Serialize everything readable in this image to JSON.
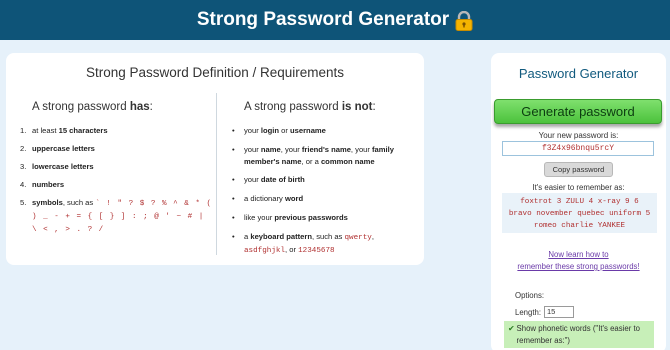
{
  "header": {
    "title": "Strong Password Generator",
    "icon": "lock-icon"
  },
  "definition": {
    "title": "Strong Password Definition / Requirements",
    "has": {
      "heading_prefix": "A strong password ",
      "heading_bold": "has",
      "heading_suffix": ":",
      "items": [
        {
          "num": "1.",
          "pre": "at least ",
          "bold": "15 characters",
          "post": ""
        },
        {
          "num": "2.",
          "pre": "",
          "bold": "uppercase letters",
          "post": ""
        },
        {
          "num": "3.",
          "pre": "",
          "bold": "lowercase letters",
          "post": ""
        },
        {
          "num": "4.",
          "pre": "",
          "bold": "numbers",
          "post": ""
        },
        {
          "num": "5.",
          "pre": "",
          "bold": "symbols",
          "post": ", such as ",
          "symbols": "` ! \" ? $ ? % ^ & * ( ) _ - + = { [ } ] : ; @ ' ~ # | \\ < , > . ? /"
        }
      ]
    },
    "not": {
      "heading_prefix": "A strong password ",
      "heading_bold": "is not",
      "heading_suffix": ":",
      "items": [
        {
          "parts": [
            {
              "t": "your "
            },
            {
              "b": "login"
            },
            {
              "t": " or "
            },
            {
              "b": "username"
            }
          ]
        },
        {
          "parts": [
            {
              "t": "your "
            },
            {
              "b": "name"
            },
            {
              "t": ", your "
            },
            {
              "b": "friend's name"
            },
            {
              "t": ", your "
            },
            {
              "b": "family member's name"
            },
            {
              "t": ", or a "
            },
            {
              "b": "common name"
            }
          ]
        },
        {
          "parts": [
            {
              "t": "your "
            },
            {
              "b": "date of birth"
            }
          ]
        },
        {
          "parts": [
            {
              "t": "a dictionary "
            },
            {
              "b": "word"
            }
          ]
        },
        {
          "parts": [
            {
              "t": "like your "
            },
            {
              "b": "previous passwords"
            }
          ]
        },
        {
          "parts": [
            {
              "t": "a "
            },
            {
              "b": "keyboard pattern"
            },
            {
              "t": ", such as "
            },
            {
              "c": "qwerty"
            },
            {
              "t": ", "
            },
            {
              "c": "asdfghjkl"
            },
            {
              "t": ", or "
            },
            {
              "c": "12345678"
            }
          ]
        }
      ]
    }
  },
  "generator": {
    "title": "Password Generator",
    "generate_label": "Generate password",
    "new_password_label": "Your new password is:",
    "password": "f3Z4x96bnqu5rcY",
    "copy_label": "Copy password",
    "easier_label": "It's easier to remember as:",
    "phonetic_lines": [
      "foxtrot 3 ZULU 4 x-ray 9 6",
      "bravo november quebec uniform 5",
      "romeo charlie YANKEE"
    ],
    "learn_line1": "Now learn how to",
    "learn_line2": "remember these strong passwords!",
    "options_label": "Options:",
    "length_label": "Length:",
    "length_value": "15",
    "phonetic_toggle_label": "Show phonetic words (\"It's easier to remember as:\")",
    "phonetic_checked": true
  },
  "colors": {
    "header": "#0e5478",
    "accent_green": "#4cc23c",
    "code_red": "#b03030",
    "link": "#6a3aa8"
  }
}
